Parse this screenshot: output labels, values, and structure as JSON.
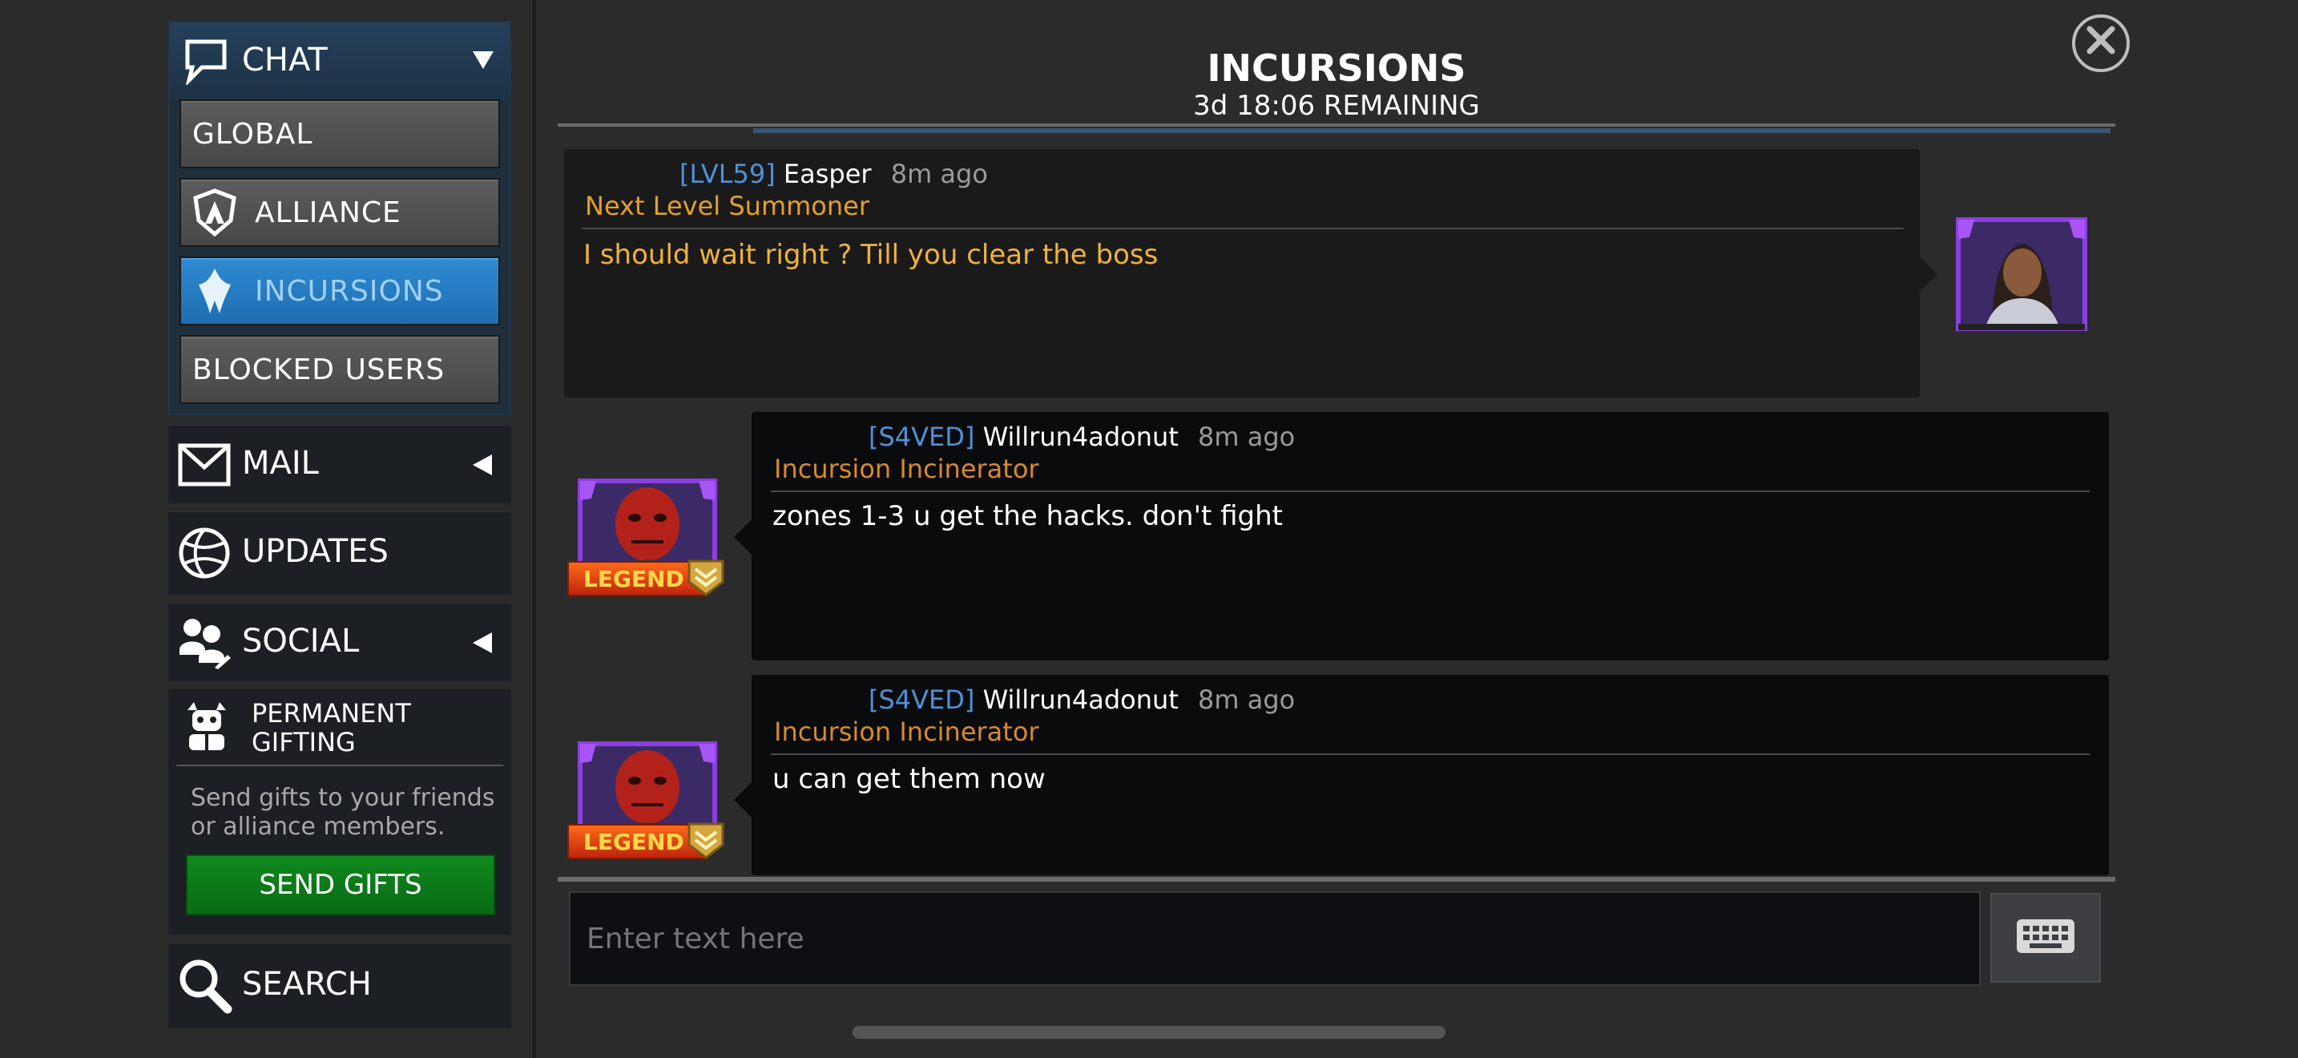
{
  "sidebar": {
    "chat": {
      "label": "CHAT",
      "items": [
        {
          "label": "GLOBAL"
        },
        {
          "label": "ALLIANCE"
        },
        {
          "label": "INCURSIONS"
        },
        {
          "label": "BLOCKED USERS"
        }
      ]
    },
    "mail": {
      "label": "MAIL"
    },
    "updates": {
      "label": "UPDATES"
    },
    "social": {
      "label": "SOCIAL"
    },
    "gifting": {
      "title": "PERMANENT GIFTING",
      "description": "Send gifts to your friends or alliance members.",
      "button": "SEND GIFTS"
    },
    "search": {
      "label": "SEARCH"
    }
  },
  "header": {
    "title": "INCURSIONS",
    "subtitle": "3d 18:06 REMAINING"
  },
  "messages": [
    {
      "tag": "[LVL59]",
      "username": "Easper",
      "time": "8m ago",
      "rank": "Next Level Summoner",
      "text": "I should wait right ? Till you clear the boss"
    },
    {
      "tag": "[S4VED]",
      "username": "Willrun4adonut",
      "time": "8m ago",
      "rank": "Incursion Incinerator",
      "text": "zones 1-3 u get the hacks. don't fight",
      "badge": "LEGEND"
    },
    {
      "tag": "[S4VED]",
      "username": "Willrun4adonut",
      "time": "8m ago",
      "rank": "Incursion Incinerator",
      "text": "u can get them now",
      "badge": "LEGEND"
    }
  ],
  "input": {
    "placeholder": "Enter text here"
  },
  "colors": {
    "accent_blue": "#2f8bd3",
    "gold_text": "#f0b23a",
    "send_green": "#0f8a1e",
    "tag_blue": "#4e92d8"
  }
}
